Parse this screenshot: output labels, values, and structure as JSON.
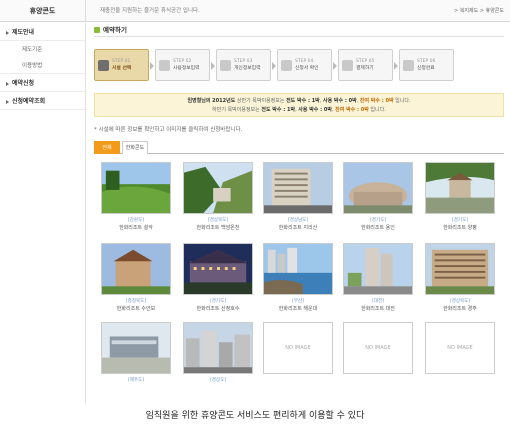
{
  "header": {
    "title": "휴양콘도",
    "tagline": "재충전을 지원하는 즐거운 휴식공간 입니다.",
    "breadcrumb": "> 복지제도 > 휴양콘도"
  },
  "sidebar": {
    "items": [
      {
        "label": "제도안내"
      },
      {
        "label": "제도기준"
      },
      {
        "label": "이용방법"
      },
      {
        "label": "예약신청"
      },
      {
        "label": "신청예약조회"
      }
    ]
  },
  "main": {
    "title": "예약하기",
    "steps": [
      {
        "num": "STEP 01",
        "label": "시설 선택"
      },
      {
        "num": "STEP 02",
        "label": "사용정보입력"
      },
      {
        "num": "STEP 03",
        "label": "개인정보입력"
      },
      {
        "num": "STEP 04",
        "label": "신청서 확인"
      },
      {
        "num": "STEP 05",
        "label": "결제하기"
      },
      {
        "num": "STEP 06",
        "label": "신청완료"
      }
    ],
    "notice": {
      "line1_pre": "임영철님의 2012년도",
      "line1_mid": "상반기 목박이용정보는 ",
      "line1_b1": "전도 박수 : 1박",
      "line1_sep1": ", ",
      "line1_b2": "사용 박수 : 0박",
      "line1_sep2": ", ",
      "line1_b3": "잔여 박수 : 0박",
      "line1_end": " 입니다.",
      "line2_pre": "하반기 목박이용정보는 ",
      "line2_b1": "전도 박수 : 1박",
      "line2_sep1": ", ",
      "line2_b2": "사용 박수 : 0박",
      "line2_sep2": ", ",
      "line2_b3": "잔여 박수 : 0박",
      "line2_end": " 입니다."
    },
    "hint": "* 시설에 따른 정보를 확인하고 이미지를 클릭하여 신청바랍니다.",
    "tabs": [
      {
        "label": "전체"
      },
      {
        "label": "한화콘도"
      }
    ],
    "no_image_label": "NO IMAGE",
    "resorts": [
      {
        "region": "[강원도]",
        "name": "한화리조트 설악",
        "scene": "golf"
      },
      {
        "region": "[경상북도]",
        "name": "한화리조트 백암온천",
        "scene": "forest"
      },
      {
        "region": "[경상남도]",
        "name": "한화리조트 지리산",
        "scene": "hotel"
      },
      {
        "region": "[경기도]",
        "name": "한화리조트 용인",
        "scene": "dome"
      },
      {
        "region": "[경기도]",
        "name": "한화리조트 양평",
        "scene": "pavilion"
      },
      {
        "region": "[충청북도]",
        "name": "한화리조트 수안보",
        "scene": "castle"
      },
      {
        "region": "[경기도]",
        "name": "한화리조트 산정호수",
        "scene": "night"
      },
      {
        "region": "[부산]",
        "name": "한화리조트 해운대",
        "scene": "coast"
      },
      {
        "region": "[대전]",
        "name": "한화리조트 대전",
        "scene": "tower"
      },
      {
        "region": "[경상북도]",
        "name": "한화리조트 경주",
        "scene": "block"
      },
      {
        "region": "[제주도]",
        "name": "",
        "scene": "sign"
      },
      {
        "region": "[경상도]",
        "name": "",
        "scene": "city"
      },
      {
        "region": "",
        "name": "",
        "scene": "none"
      },
      {
        "region": "",
        "name": "",
        "scene": "none"
      },
      {
        "region": "",
        "name": "",
        "scene": "none"
      }
    ]
  },
  "caption": "임직원을 위한 휴양콘도 서비스도 편리하게 이용할 수 있다",
  "colors": {
    "accent": "#f29a1a",
    "step_active": "#e9d9a8",
    "notice_bg": "#fbf4d7",
    "region_text": "#6a8fbf"
  }
}
